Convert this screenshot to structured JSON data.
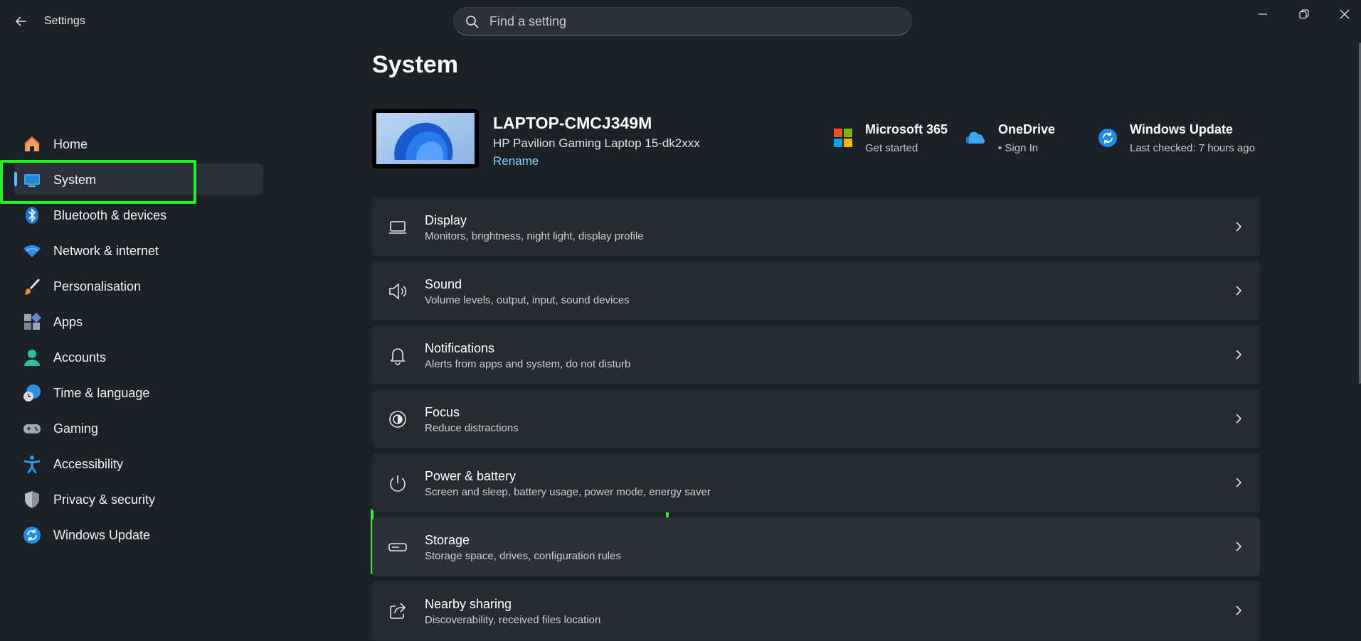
{
  "window": {
    "title": "Settings",
    "search_placeholder": "Find a setting"
  },
  "sidebar": {
    "items": [
      {
        "label": "Home",
        "icon": "home-icon"
      },
      {
        "label": "System",
        "icon": "system-icon",
        "active": true
      },
      {
        "label": "Bluetooth & devices",
        "icon": "bluetooth-icon"
      },
      {
        "label": "Network & internet",
        "icon": "wifi-icon"
      },
      {
        "label": "Personalisation",
        "icon": "brush-icon"
      },
      {
        "label": "Apps",
        "icon": "apps-icon"
      },
      {
        "label": "Accounts",
        "icon": "accounts-icon"
      },
      {
        "label": "Time & language",
        "icon": "time-language-icon"
      },
      {
        "label": "Gaming",
        "icon": "gamepad-icon"
      },
      {
        "label": "Accessibility",
        "icon": "accessibility-icon"
      },
      {
        "label": "Privacy & security",
        "icon": "shield-icon"
      },
      {
        "label": "Windows Update",
        "icon": "windows-update-icon"
      }
    ]
  },
  "main": {
    "title": "System",
    "device": {
      "name": "LAPTOP-CMCJ349M",
      "model": "HP Pavilion Gaming Laptop 15-dk2xxx",
      "rename": "Rename"
    },
    "quick": [
      {
        "title": "Microsoft 365",
        "subtitle": "Get started",
        "icon": "microsoft-365-icon"
      },
      {
        "title": "OneDrive",
        "subtitle": "• Sign In",
        "icon": "onedrive-icon"
      },
      {
        "title": "Windows Update",
        "subtitle": "Last checked: 7 hours ago",
        "icon": "windows-update-icon"
      }
    ],
    "cards": [
      {
        "title": "Display",
        "subtitle": "Monitors, brightness, night light, display profile",
        "icon": "display-icon"
      },
      {
        "title": "Sound",
        "subtitle": "Volume levels, output, input, sound devices",
        "icon": "speaker-icon"
      },
      {
        "title": "Notifications",
        "subtitle": "Alerts from apps and system, do not disturb",
        "icon": "bell-icon"
      },
      {
        "title": "Focus",
        "subtitle": "Reduce distractions",
        "icon": "focus-icon"
      },
      {
        "title": "Power & battery",
        "subtitle": "Screen and sleep, battery usage, power mode, energy saver",
        "icon": "power-icon"
      },
      {
        "title": "Storage",
        "subtitle": "Storage space, drives, configuration rules",
        "icon": "storage-icon"
      },
      {
        "title": "Nearby sharing",
        "subtitle": "Discoverability, received files location",
        "icon": "share-icon"
      }
    ]
  },
  "colors": {
    "background": "#1c2027",
    "card": "#262a31",
    "accent": "#4cc2ff",
    "highlight": "#1ff51f"
  }
}
